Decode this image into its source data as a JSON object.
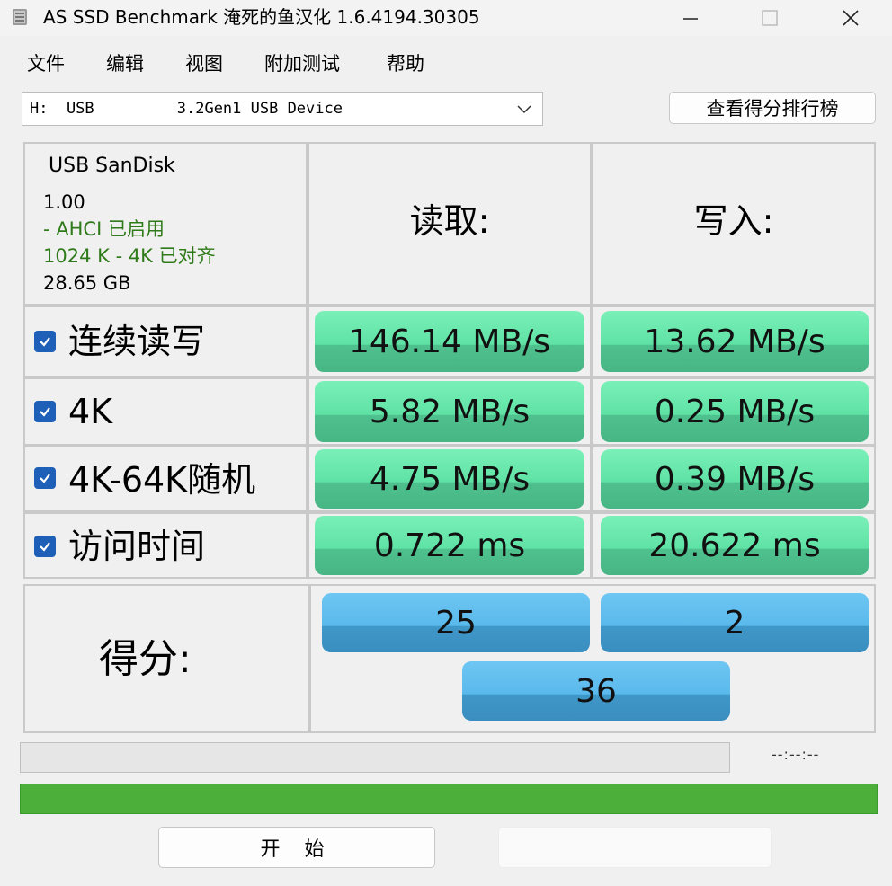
{
  "window": {
    "title": "AS SSD Benchmark 淹死的鱼汉化 1.6.4194.30305"
  },
  "menu": [
    "文件",
    "编辑",
    "视图",
    "附加测试",
    "帮助"
  ],
  "drive_selector": {
    "value": "H:  USB         3.2Gen1 USB Device"
  },
  "ranking_button": "查看得分排行榜",
  "drive_info": {
    "name": "USB  SanDisk",
    "firmware": "1.00",
    "ahci": " - AHCI 已启用",
    "alignment": "1024 K - 4K 已对齐",
    "capacity": "28.65 GB"
  },
  "headers": {
    "read": "读取:",
    "write": "写入:"
  },
  "rows": [
    {
      "label": "连续读写",
      "read": "146.14 MB/s",
      "write": "13.62 MB/s",
      "checked": true
    },
    {
      "label": "4K",
      "read": "5.82 MB/s",
      "write": "0.25 MB/s",
      "checked": true
    },
    {
      "label": "4K-64K随机",
      "read": "4.75 MB/s",
      "write": "0.39 MB/s",
      "checked": true
    },
    {
      "label": "访问时间",
      "read": "0.722 ms",
      "write": "20.622 ms",
      "checked": true
    }
  ],
  "score": {
    "label": "得分:",
    "read": "25",
    "write": "2",
    "total": "36"
  },
  "progress": {
    "elapsed": "--:--:--",
    "status_fraction": 1.0
  },
  "buttons": {
    "start": "开 始",
    "abort": ""
  },
  "colors": {
    "result_green": "#5fe2a5",
    "score_blue": "#5ab9ec",
    "status_green": "#4caf3a",
    "checkbox_blue": "#1e5fb8"
  }
}
